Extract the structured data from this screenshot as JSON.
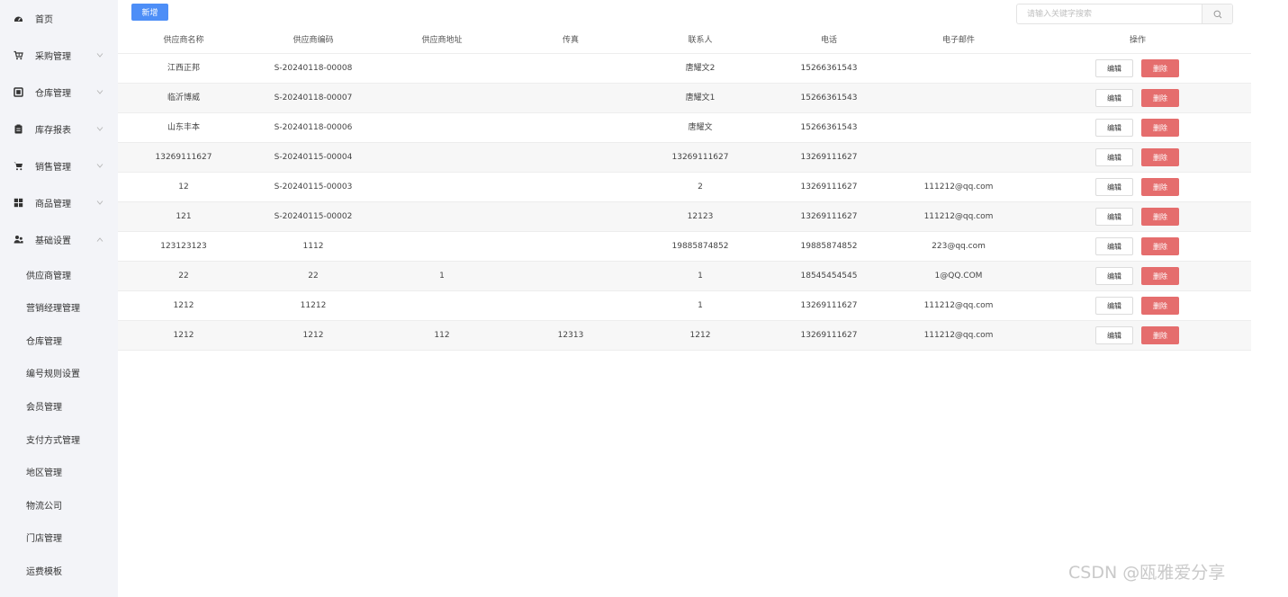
{
  "sidebar": {
    "menu": [
      {
        "label": "首页",
        "icon": "dashboard-icon",
        "expandable": false
      },
      {
        "label": "采购管理",
        "icon": "cart-plus-icon",
        "expandable": true
      },
      {
        "label": "仓库管理",
        "icon": "warehouse-icon",
        "expandable": true
      },
      {
        "label": "库存报表",
        "icon": "report-icon",
        "expandable": true
      },
      {
        "label": "销售管理",
        "icon": "cart-icon",
        "expandable": true
      },
      {
        "label": "商品管理",
        "icon": "grid-icon",
        "expandable": true
      },
      {
        "label": "基础设置",
        "icon": "users-icon",
        "expandable": true,
        "expanded": true
      }
    ],
    "submenu": [
      {
        "label": "供应商管理"
      },
      {
        "label": "营销经理管理"
      },
      {
        "label": "仓库管理"
      },
      {
        "label": "编号规则设置"
      },
      {
        "label": "会员管理"
      },
      {
        "label": "支付方式管理"
      },
      {
        "label": "地区管理"
      },
      {
        "label": "物流公司"
      },
      {
        "label": "门店管理"
      },
      {
        "label": "运费模板"
      }
    ]
  },
  "toolbar": {
    "add_label": "新增",
    "search_placeholder": "请输入关键字搜索"
  },
  "table": {
    "columns": [
      "供应商名称",
      "供应商编码",
      "供应商地址",
      "传真",
      "联系人",
      "电话",
      "电子邮件",
      "操作"
    ],
    "edit_label": "编辑",
    "delete_label": "删除",
    "rows": [
      [
        "江西正邦",
        "S-20240118-00008",
        "",
        "",
        "唐耀文2",
        "15266361543",
        ""
      ],
      [
        "临沂博威",
        "S-20240118-00007",
        "",
        "",
        "唐耀文1",
        "15266361543",
        ""
      ],
      [
        "山东丰本",
        "S-20240118-00006",
        "",
        "",
        "唐耀文",
        "15266361543",
        ""
      ],
      [
        "13269111627",
        "S-20240115-00004",
        "",
        "",
        "13269111627",
        "13269111627",
        ""
      ],
      [
        "12",
        "S-20240115-00003",
        "",
        "",
        "2",
        "13269111627",
        "111212@qq.com"
      ],
      [
        "121",
        "S-20240115-00002",
        "",
        "",
        "12123",
        "13269111627",
        "111212@qq.com"
      ],
      [
        "123123123",
        "1112",
        "",
        "",
        "19885874852",
        "19885874852",
        "223@qq.com"
      ],
      [
        "22",
        "22",
        "1",
        "",
        "1",
        "18545454545",
        "1@QQ.COM"
      ],
      [
        "1212",
        "11212",
        "",
        "",
        "1",
        "13269111627",
        "111212@qq.com"
      ],
      [
        "1212",
        "1212",
        "112",
        "12313",
        "1212",
        "13269111627",
        "111212@qq.com"
      ]
    ]
  },
  "watermark": "CSDN @瓯雅爱分享"
}
